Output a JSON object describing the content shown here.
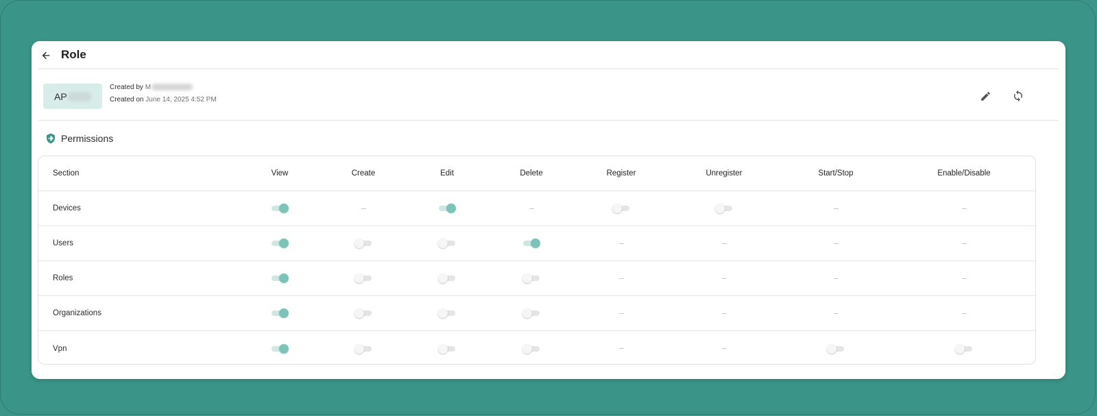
{
  "header": {
    "title": "Role"
  },
  "role": {
    "badge_prefix": "AP",
    "created_by_label": "Created by",
    "created_by_value": "M",
    "created_on_label": "Created on",
    "created_on_value": "June 14, 2025 4:52 PM"
  },
  "actions": {
    "edit_icon": "pencil-icon",
    "refresh_icon": "sync-icon"
  },
  "permissions": {
    "title": "Permissions",
    "icon": "shield-icon",
    "columns": [
      "Section",
      "View",
      "Create",
      "Edit",
      "Delete",
      "Register",
      "Unregister",
      "Start/Stop",
      "Enable/Disable"
    ],
    "rows": [
      {
        "section": "Devices",
        "values": [
          "on",
          "na",
          "on",
          "na",
          "off",
          "off",
          "na",
          "na"
        ]
      },
      {
        "section": "Users",
        "values": [
          "on",
          "off",
          "off",
          "on",
          "na",
          "na",
          "na",
          "na"
        ]
      },
      {
        "section": "Roles",
        "values": [
          "on",
          "off",
          "off",
          "off",
          "na",
          "na",
          "na",
          "na"
        ]
      },
      {
        "section": "Organizations",
        "values": [
          "on",
          "off",
          "off",
          "off",
          "na",
          "na",
          "na",
          "na"
        ]
      },
      {
        "section": "Vpn",
        "values": [
          "on",
          "off",
          "off",
          "off",
          "na",
          "na",
          "off",
          "off"
        ]
      }
    ]
  },
  "colors": {
    "background": "#3a9488",
    "accent": "#7cc3b8",
    "badge_bg": "#d8ece9"
  }
}
